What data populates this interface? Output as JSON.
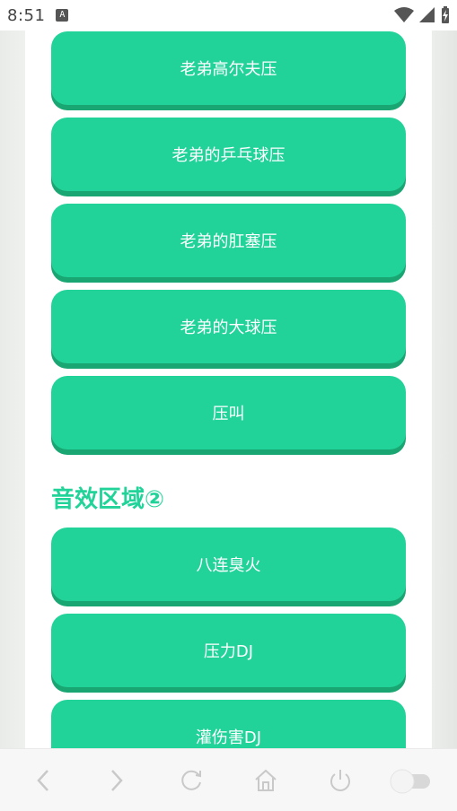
{
  "status_bar": {
    "time": "8:51",
    "app_icon_letter": "A"
  },
  "buttons_top": [
    {
      "label": "老弟高尔夫压"
    },
    {
      "label": "老弟的乒乓球压"
    },
    {
      "label": "老弟的肛塞压"
    },
    {
      "label": "老弟的大球压"
    },
    {
      "label": "压叫"
    }
  ],
  "section_2": {
    "title": "音效区域②",
    "buttons": [
      {
        "label": "八连臭火"
      },
      {
        "label": "压力DJ"
      },
      {
        "label": "灌伤害DJ"
      }
    ]
  },
  "colors": {
    "accent": "#22d399",
    "accent_shadow": "#1aa673"
  },
  "bottom_nav": {
    "icons": [
      "back-icon",
      "forward-icon",
      "refresh-icon",
      "home-icon",
      "power-icon",
      "toggle-switch"
    ]
  }
}
